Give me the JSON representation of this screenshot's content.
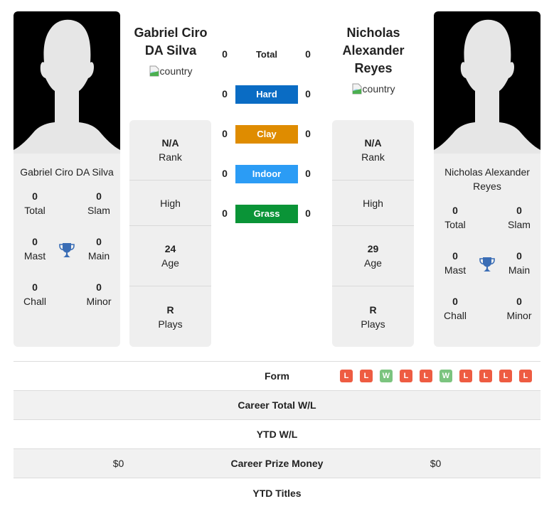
{
  "player1": {
    "name": "Gabriel Ciro DA Silva",
    "name_line1": "Gabriel Ciro",
    "name_line2": "DA Silva",
    "country_alt": "country",
    "titles": {
      "total": "0",
      "total_label": "Total",
      "slam": "0",
      "slam_label": "Slam",
      "mast": "0",
      "mast_label": "Mast",
      "main": "0",
      "main_label": "Main",
      "chall": "0",
      "chall_label": "Chall",
      "minor": "0",
      "minor_label": "Minor"
    },
    "stats": {
      "rank": "N/A",
      "rank_label": "Rank",
      "high_label": "High",
      "age": "24",
      "age_label": "Age",
      "plays": "R",
      "plays_label": "Plays"
    },
    "prize_money": "$0"
  },
  "player2": {
    "name": "Nicholas Alexander Reyes",
    "name_line1": "Nicholas",
    "name_line2": "Alexander Reyes",
    "card_name_line1": "Nicholas Alexander",
    "card_name_line2": "Reyes",
    "country_alt": "country",
    "titles": {
      "total": "0",
      "total_label": "Total",
      "slam": "0",
      "slam_label": "Slam",
      "mast": "0",
      "mast_label": "Mast",
      "main": "0",
      "main_label": "Main",
      "chall": "0",
      "chall_label": "Chall",
      "minor": "0",
      "minor_label": "Minor"
    },
    "stats": {
      "rank": "N/A",
      "rank_label": "Rank",
      "high_label": "High",
      "age": "29",
      "age_label": "Age",
      "plays": "R",
      "plays_label": "Plays"
    },
    "prize_money": "$0"
  },
  "surfaces": [
    {
      "label": "Total",
      "p1": "0",
      "p2": "0",
      "color": ""
    },
    {
      "label": "Hard",
      "p1": "0",
      "p2": "0",
      "color": "#0a6cc4"
    },
    {
      "label": "Clay",
      "p1": "0",
      "p2": "0",
      "color": "#df8c00"
    },
    {
      "label": "Indoor",
      "p1": "0",
      "p2": "0",
      "color": "#2b9cf5"
    },
    {
      "label": "Grass",
      "p1": "0",
      "p2": "0",
      "color": "#0a9437"
    }
  ],
  "bottom": {
    "form_label": "Form",
    "form": [
      "L",
      "L",
      "W",
      "L",
      "L",
      "W",
      "L",
      "L",
      "L",
      "L"
    ],
    "career_wl_label": "Career Total W/L",
    "ytd_wl_label": "YTD W/L",
    "prize_label": "Career Prize Money",
    "ytd_titles_label": "YTD Titles"
  },
  "colors": {
    "trophy": "#3a6db5",
    "loss": "#ee5c42",
    "win": "#7bc47f"
  }
}
